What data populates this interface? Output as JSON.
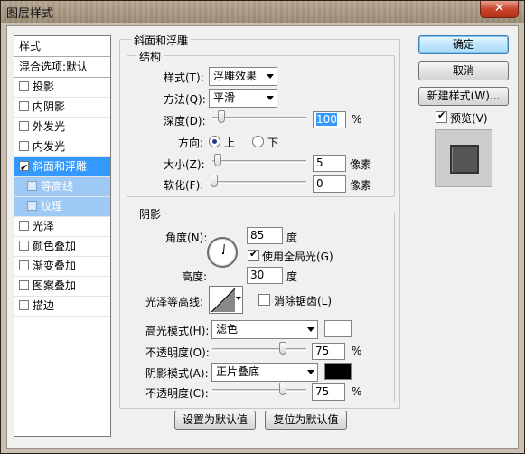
{
  "window": {
    "title": "图层样式",
    "close_label": "✕"
  },
  "stylelist": {
    "header": "样式",
    "blend": "混合选项:默认",
    "items": [
      {
        "label": "投影",
        "checked": false
      },
      {
        "label": "内阴影",
        "checked": false
      },
      {
        "label": "外发光",
        "checked": false
      },
      {
        "label": "内发光",
        "checked": false
      },
      {
        "label": "斜面和浮雕",
        "checked": true,
        "selected": true
      },
      {
        "label": "等高线",
        "checked": false,
        "sub": true
      },
      {
        "label": "纹理",
        "checked": false,
        "sub": true
      },
      {
        "label": "光泽",
        "checked": false
      },
      {
        "label": "颜色叠加",
        "checked": false
      },
      {
        "label": "渐变叠加",
        "checked": false
      },
      {
        "label": "图案叠加",
        "checked": false
      },
      {
        "label": "描边",
        "checked": false
      }
    ]
  },
  "bevel": {
    "title": "斜面和浮雕",
    "structure": {
      "title": "结构",
      "style_label": "样式(T):",
      "style_value": "浮雕效果",
      "method_label": "方法(Q):",
      "method_value": "平滑",
      "depth_label": "深度(D):",
      "depth_value": "100",
      "depth_unit": "%",
      "depth_level": 0.1,
      "direction_label": "方向:",
      "dir_up": "上",
      "dir_down": "下",
      "size_label": "大小(Z):",
      "size_value": "5",
      "size_unit": "像素",
      "soften_label": "软化(F):",
      "soften_value": "0",
      "soften_unit": "像素"
    },
    "shading": {
      "title": "阴影",
      "angle_label": "角度(N):",
      "angle_value": "85",
      "angle_unit": "度",
      "global_light_label": "使用全局光(G)",
      "altitude_label": "高度:",
      "altitude_value": "30",
      "altitude_unit": "度",
      "gloss_label": "光泽等高线:",
      "antialias_label": "消除锯齿(L)",
      "highlight_label": "高光模式(H):",
      "highlight_value": "滤色",
      "highlight_color": "#ffffff",
      "hl_opacity_label": "不透明度(O):",
      "hl_opacity_value": "75",
      "hl_opacity_unit": "%",
      "shadow_label": "阴影模式(A):",
      "shadow_value": "正片叠底",
      "shadow_color": "#000000",
      "sh_opacity_label": "不透明度(C):",
      "sh_opacity_value": "75",
      "sh_opacity_unit": "%"
    },
    "set_default": "设置为默认值",
    "reset_default": "复位为默认值"
  },
  "buttons": {
    "ok": "确定",
    "cancel": "取消",
    "new_style": "新建样式(W)...",
    "preview_label": "预览(V)"
  }
}
